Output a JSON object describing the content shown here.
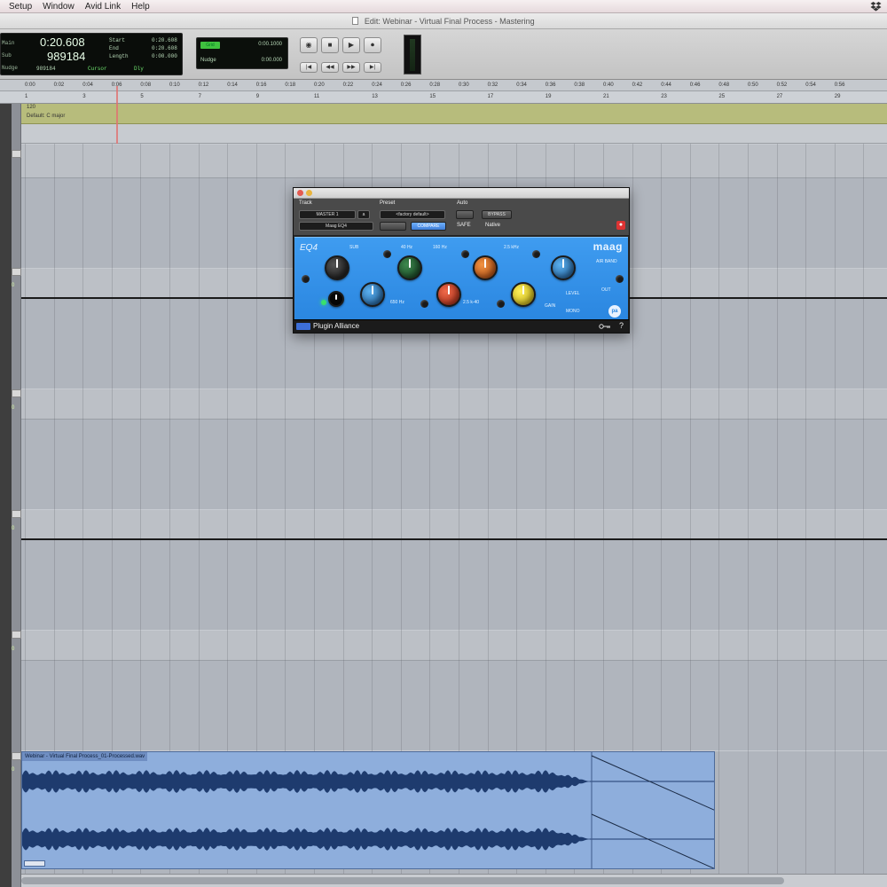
{
  "menu": [
    "Setup",
    "Window",
    "Avid Link",
    "Help"
  ],
  "window_title": "Edit: Webinar - Virtual Final Process - Mastering",
  "counter": {
    "main": "0:20.608",
    "sub": "989184",
    "labels": [
      "Main",
      "Sub",
      "Nudge"
    ],
    "start_label": "Start",
    "end_label": "End",
    "length_label": "Length",
    "start": "0:20.608",
    "end": "0:20.608",
    "length": "0:00.000",
    "cursor_label": "Cursor",
    "cursor_val": "989184",
    "status": "Dly"
  },
  "mini": {
    "grid_label": "Grid",
    "grid_value": "0:00.1000",
    "nudge_label": "Nudge",
    "nudge_value": "0:00.000"
  },
  "transport": [
    "◉",
    "■",
    "▶",
    "⏺"
  ],
  "transport_small": [
    "|◀",
    "◀◀",
    "▶▶",
    "▶|"
  ],
  "ruler_times": [
    "0:00",
    "0:02",
    "0:04",
    "0:06",
    "0:08",
    "0:10",
    "0:12",
    "0:14",
    "0:16",
    "0:18",
    "0:20",
    "0:22",
    "0:24",
    "0:26",
    "0:28",
    "0:30",
    "0:32",
    "0:34",
    "0:36",
    "0:38",
    "0:40",
    "0:42",
    "0:44",
    "0:46",
    "0:48",
    "0:50",
    "0:52",
    "0:54",
    "0:56"
  ],
  "ruler_bars": [
    "1",
    "3",
    "5",
    "7",
    "9",
    "11",
    "13",
    "15",
    "17",
    "19",
    "21",
    "23",
    "25",
    "27",
    "29",
    "31"
  ],
  "markers": {
    "tempo": "120",
    "key": "Default: C major"
  },
  "left_volumes": [
    "0",
    "0",
    "0",
    "0",
    "0"
  ],
  "clip": {
    "name": "Webinar - Virtual Final Process_01-Processed.wav"
  },
  "plugin": {
    "track_label": "Track",
    "preset_label": "Preset",
    "auto_label": "Auto",
    "track_name": "MASTER 1",
    "track_slot": "a",
    "plugin_name": "Maag EQ4",
    "preset_name": "<factory default>",
    "compare_label": "COMPARE",
    "bypass_label": "BYPASS",
    "native_label": "Native",
    "safe_label": "SAFE",
    "logo": "maag",
    "eq_logo": "EQ4",
    "footer_name": "Plugin Alliance",
    "help": "?",
    "labels": {
      "sub": "SUB",
      "hz40": "40 Hz",
      "hz160": "160 Hz",
      "hz650": "650 Hz",
      "k25": "2.5 kHz",
      "air": "AIR BAND",
      "gain": "GAIN",
      "khz": "2.5 k-40",
      "level": "LEVEL",
      "out": "OUT",
      "mono": "MONO"
    }
  }
}
